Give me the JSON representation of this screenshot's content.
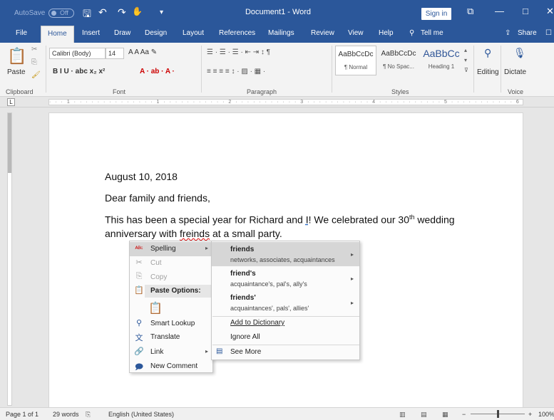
{
  "titlebar": {
    "autosave_label": "AutoSave",
    "autosave_state": "Off",
    "doc_title": "Document1 - Word",
    "signin": "Sign in",
    "save_glyph": "🖫",
    "undo_glyph": "↶",
    "redo_glyph": "↷",
    "touch_glyph": "✋",
    "more_glyph": "▾",
    "restore_glyph": "⧉",
    "minimize_glyph": "—",
    "maximize_glyph": "□",
    "close_glyph": "✕"
  },
  "tabs": [
    "File",
    "Home",
    "Insert",
    "Draw",
    "Design",
    "Layout",
    "References",
    "Mailings",
    "Review",
    "View",
    "Help"
  ],
  "tell_me": "Tell me",
  "share": "Share",
  "ribbon": {
    "paste": "Paste",
    "font_name": "Calibri (Body)",
    "font_size": "14",
    "clipboard_label": "Clipboard",
    "font_label": "Font",
    "paragraph_label": "Paragraph",
    "styles_label": "Styles",
    "voice_label": "Voice",
    "editing": "Editing",
    "dictate": "Dictate",
    "styles": [
      {
        "sample": "AaBbCcDc",
        "name": "¶ Normal"
      },
      {
        "sample": "AaBbCcDc",
        "name": "¶ No Spac..."
      },
      {
        "sample": "AaBbCc",
        "name": "Heading 1"
      }
    ],
    "font_row2": "B  I  U  ·  abc  x₂  x²",
    "font_row1_icons": "A  A  Aa  ✎",
    "para_row1": "☰ · ☰ · ☰ ·  ⇤ ⇥  ↕  ¶",
    "para_row2": "≡ ≡ ≡ ≡  ↕ ·  ▨ · ▦ ·",
    "font_color_row": "A · ab · A ·"
  },
  "document": {
    "date": "August 10, 2018",
    "greeting": "Dear family and friends,",
    "line1_a": "This has been a special year for Richard and ",
    "line1_i": "I",
    "line1_b": "! We celebrated our 30",
    "line1_sup": "th",
    "line1_c": " wedding",
    "line2_a": "anniversary with ",
    "line2_misspelled": "freinds",
    "line2_b": " at a small party."
  },
  "context_menu": {
    "spelling": "Spelling",
    "cut": "Cut",
    "copy": "Copy",
    "paste_options": "Paste Options:",
    "smart_lookup": "Smart Lookup",
    "translate": "Translate",
    "link": "Link",
    "new_comment": "New Comment"
  },
  "spelling_menu": {
    "suggestions": [
      {
        "word": "friends",
        "desc": "networks, associates, acquaintances"
      },
      {
        "word": "friend's",
        "desc": "acquaintance's, pal's, ally's"
      },
      {
        "word": "friends'",
        "desc": "acquaintances', pals', allies'"
      }
    ],
    "add_to_dictionary": "Add to Dictionary",
    "ignore_all": "Ignore All",
    "see_more": "See More"
  },
  "status": {
    "page": "Page 1 of 1",
    "words": "29 words",
    "language": "English (United States)",
    "zoom": "100%",
    "minus": "−",
    "plus": "+"
  },
  "ruler_text": "· · · 1 · · · · · · · · · · · · · · 1 · · · · · · · · · · · 2 · · · · · · · · · · · 3 · · · · · · · · · · · 4 · · · · · · · · · · · 5 · · · · · · · · · · · 6 · · · · · · · · · 7 · · ·"
}
